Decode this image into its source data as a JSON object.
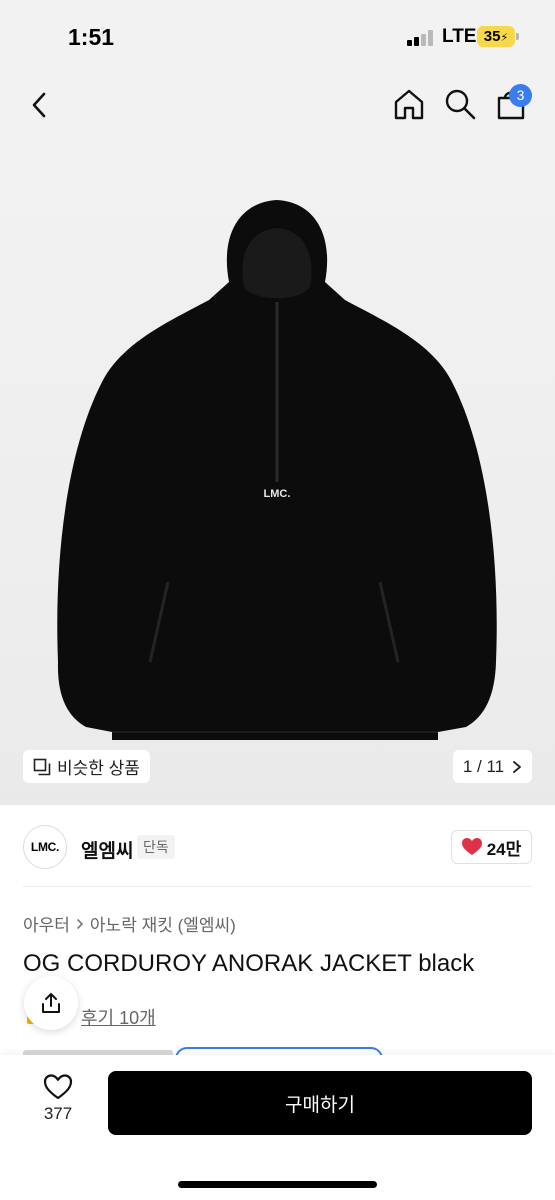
{
  "status_bar": {
    "time": "1:51",
    "network": "LTE",
    "battery": "35"
  },
  "nav": {
    "back_icon": "chevron-left-icon",
    "home_icon": "home-icon",
    "search_icon": "search-icon",
    "cart_icon": "shopping-bag-icon",
    "cart_badge": "3"
  },
  "gallery": {
    "print_label": "LMC.",
    "similar_label": "비슷한 상품",
    "pager": "1 / 11"
  },
  "brand": {
    "logo_text": "LMC.",
    "name": "엘엠씨",
    "tag": "단독",
    "likes": "24만"
  },
  "product": {
    "breadcrumb": [
      "아우터",
      "아노락 재킷 (엘엠씨)"
    ],
    "title": "OG CORDUROY ANORAK JACKET black",
    "review_link": "후기 10개"
  },
  "bottom": {
    "wish_count": "377",
    "buy_label": "구매하기"
  },
  "colors": {
    "accent": "#3b7df0",
    "heart": "#e0314b",
    "battery": "#f7d84a",
    "buy_button": "#000000"
  }
}
